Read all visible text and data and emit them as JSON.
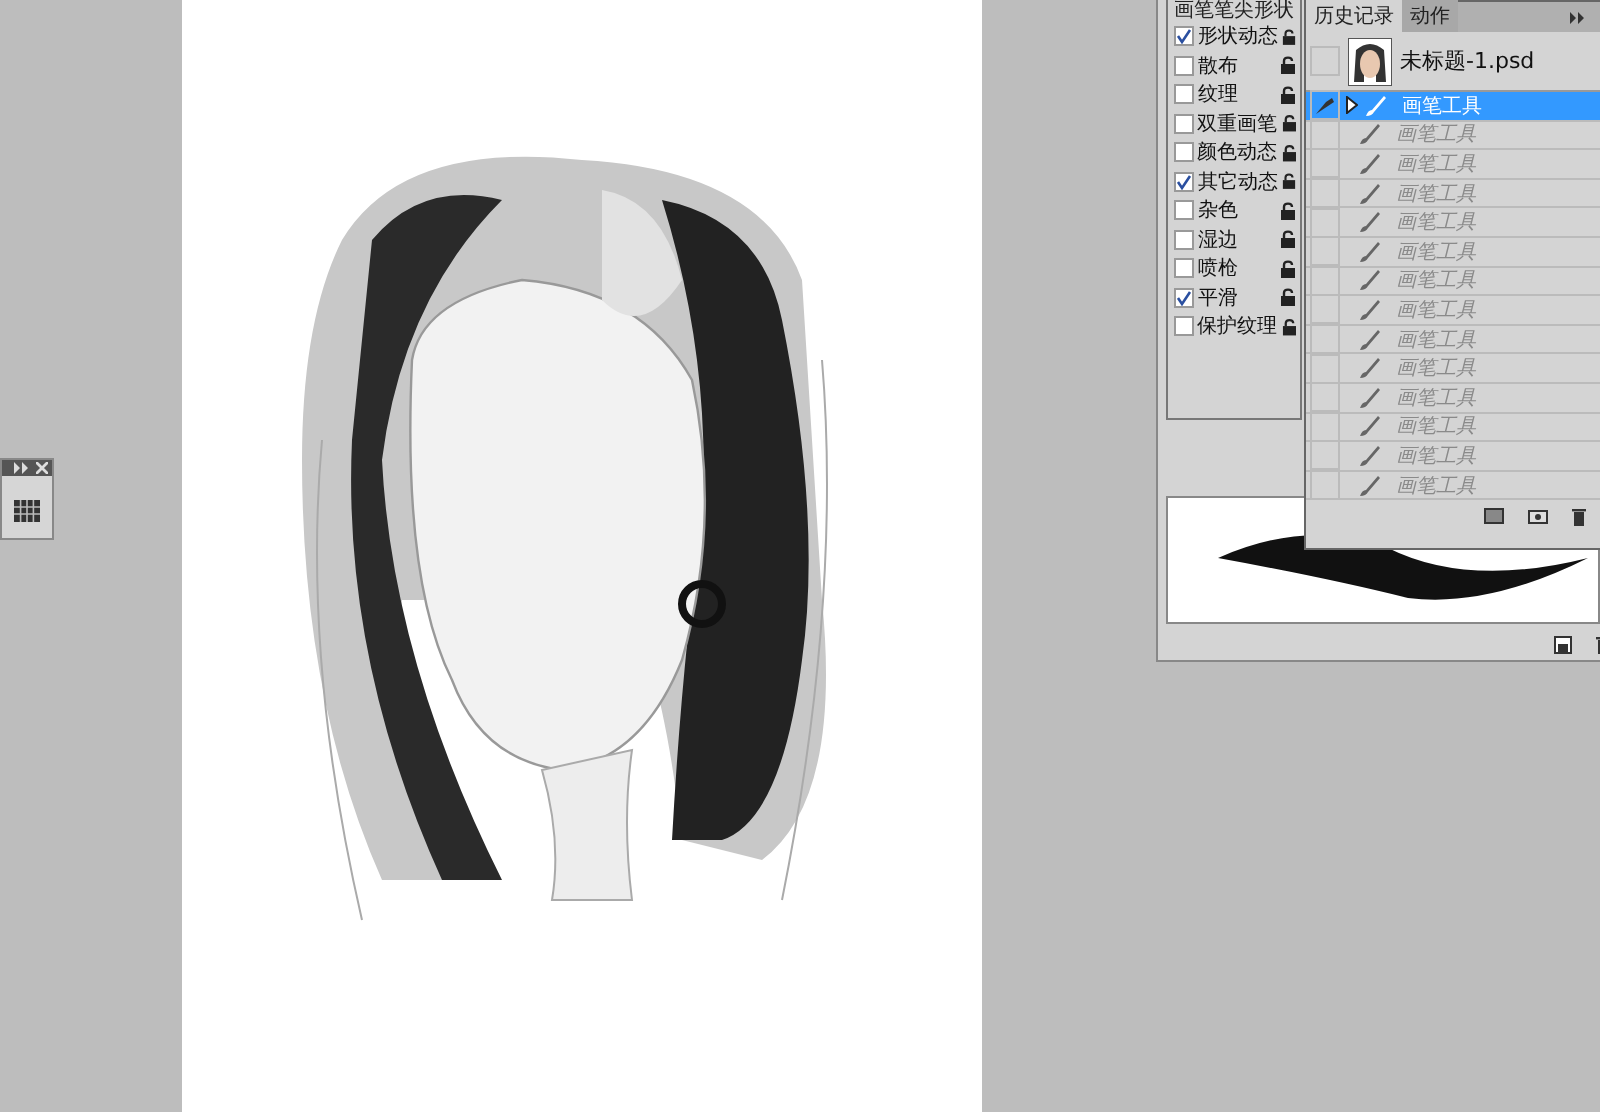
{
  "brush_panel": {
    "title": "画笔笔尖形状",
    "options": [
      {
        "label": "形状动态",
        "checked": true
      },
      {
        "label": "散布",
        "checked": false
      },
      {
        "label": "纹理",
        "checked": false
      },
      {
        "label": "双重画笔",
        "checked": false
      },
      {
        "label": "颜色动态",
        "checked": false
      },
      {
        "label": "其它动态",
        "checked": true
      },
      {
        "label": "杂色",
        "checked": false
      },
      {
        "label": "湿边",
        "checked": false
      },
      {
        "label": "喷枪",
        "checked": false
      },
      {
        "label": "平滑",
        "checked": true
      },
      {
        "label": "保护纹理",
        "checked": false
      }
    ]
  },
  "history_panel": {
    "tabs": [
      {
        "label": "历史记录",
        "selected": true
      },
      {
        "label": "动作",
        "selected": false
      }
    ],
    "snapshot": {
      "name": "未标题-1.psd"
    },
    "states": [
      {
        "label": "画笔工具",
        "selected": true,
        "undone": false
      },
      {
        "label": "画笔工具",
        "selected": false,
        "undone": true
      },
      {
        "label": "画笔工具",
        "selected": false,
        "undone": true
      },
      {
        "label": "画笔工具",
        "selected": false,
        "undone": true
      },
      {
        "label": "画笔工具",
        "selected": false,
        "undone": true
      },
      {
        "label": "画笔工具",
        "selected": false,
        "undone": true
      },
      {
        "label": "画笔工具",
        "selected": false,
        "undone": true
      },
      {
        "label": "画笔工具",
        "selected": false,
        "undone": true
      },
      {
        "label": "画笔工具",
        "selected": false,
        "undone": true
      },
      {
        "label": "画笔工具",
        "selected": false,
        "undone": true
      },
      {
        "label": "画笔工具",
        "selected": false,
        "undone": true
      },
      {
        "label": "画笔工具",
        "selected": false,
        "undone": true
      },
      {
        "label": "画笔工具",
        "selected": false,
        "undone": true
      },
      {
        "label": "画笔工具",
        "selected": false,
        "undone": true
      }
    ]
  }
}
